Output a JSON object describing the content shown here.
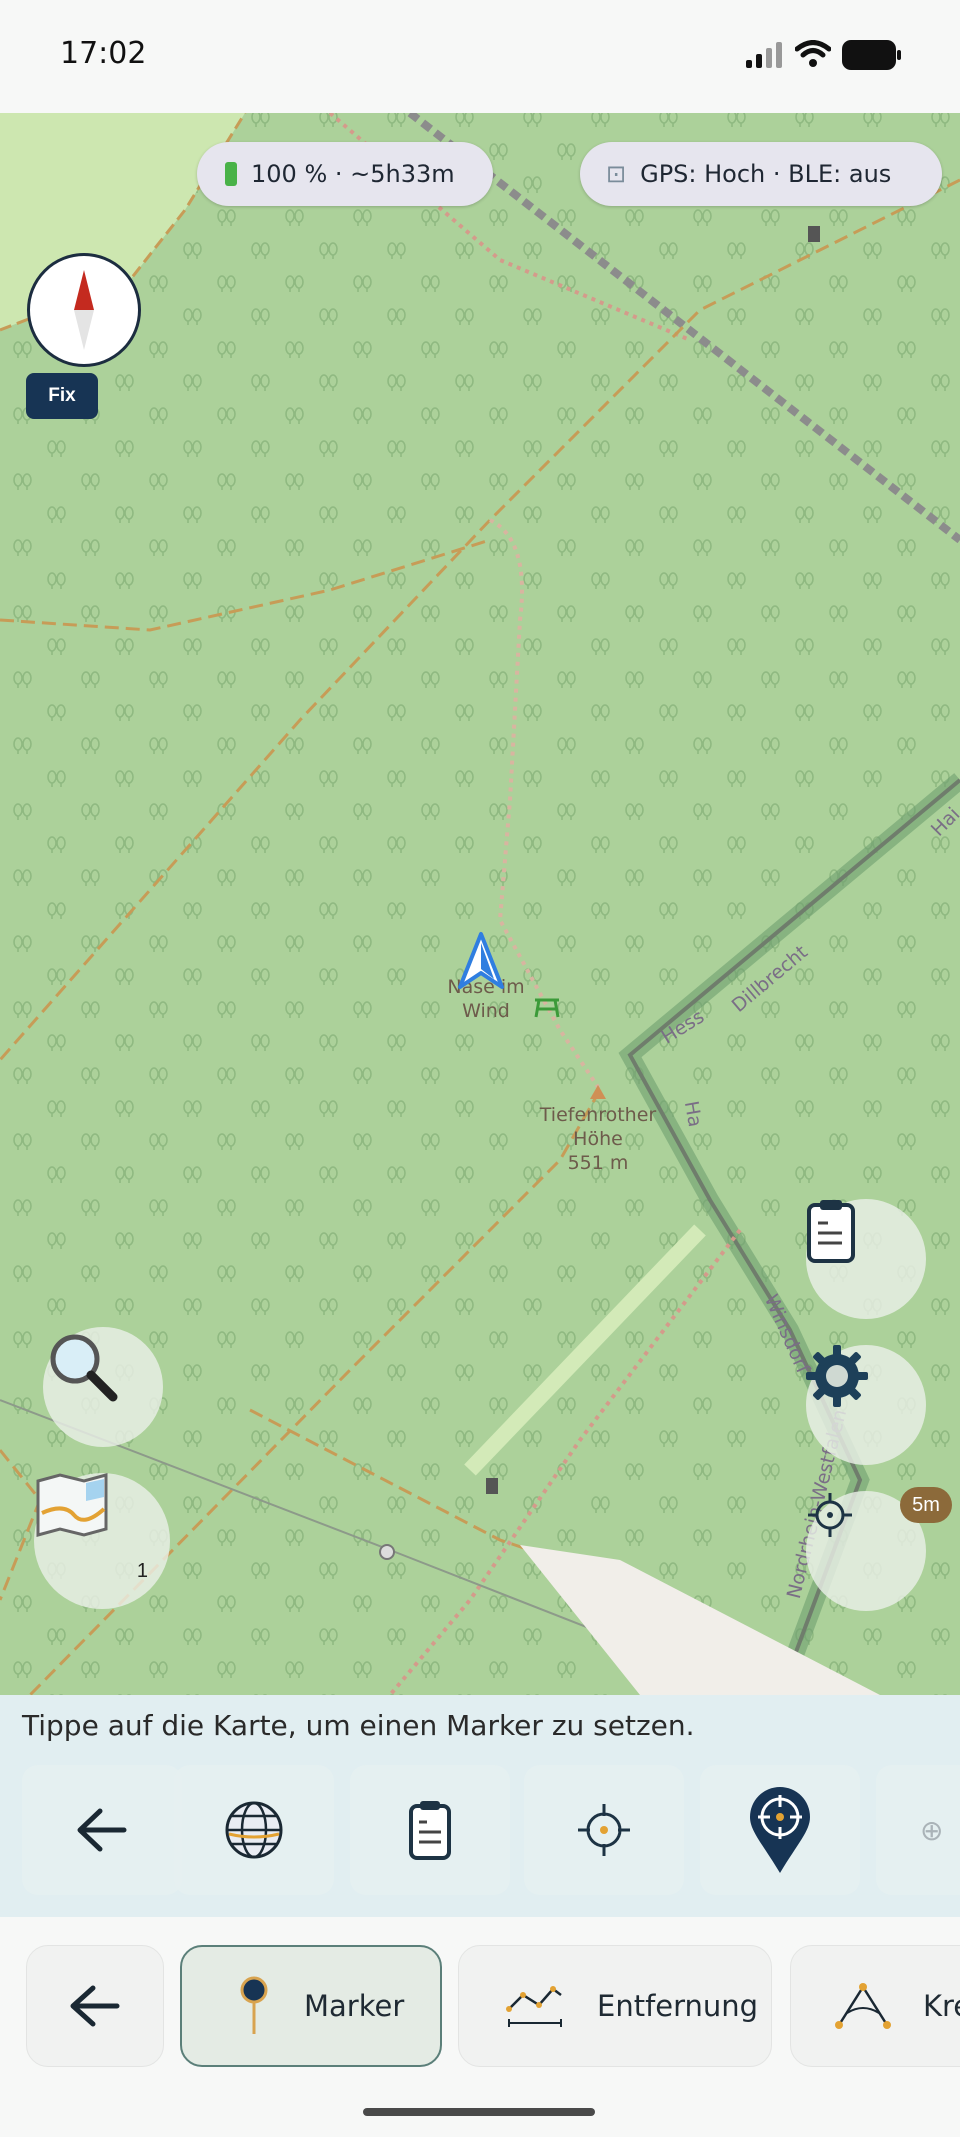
{
  "status_bar": {
    "time": "17:02"
  },
  "map": {
    "battery_status": "100 % · ~5h33m",
    "gps_status": "GPS: Hoch · BLE: aus",
    "fix_label": "Fix",
    "labels": {
      "poi_name": "Nase im Wind",
      "peak_name": "Tiefenrother Höhe",
      "peak_elevation": "551 m"
    },
    "roads": {
      "hess": "Hess",
      "dillbrecht": "Dillbrecht",
      "haiger": "Ha",
      "hai_right": "Hai",
      "winsdorf": "Winsdorf",
      "nrw": "Nordrhein-Westfalen"
    },
    "layer_count": "1",
    "accuracy_badge": "5m"
  },
  "marker_panel": {
    "hint": "Tippe auf die Karte, um einen Marker zu setzen.",
    "tools": [
      "back-arrow-icon",
      "globe-icon",
      "clipboard-icon",
      "crosshair-icon",
      "marker-pin-icon"
    ]
  },
  "bottom_nav": {
    "back": "back",
    "marker": "Marker",
    "distance": "Entfernung",
    "circle": "Kre"
  },
  "colors": {
    "map_forest": "#acd19a",
    "panel": "#e1eef1",
    "accent_dark": "#173454",
    "path": "#c79c57"
  }
}
